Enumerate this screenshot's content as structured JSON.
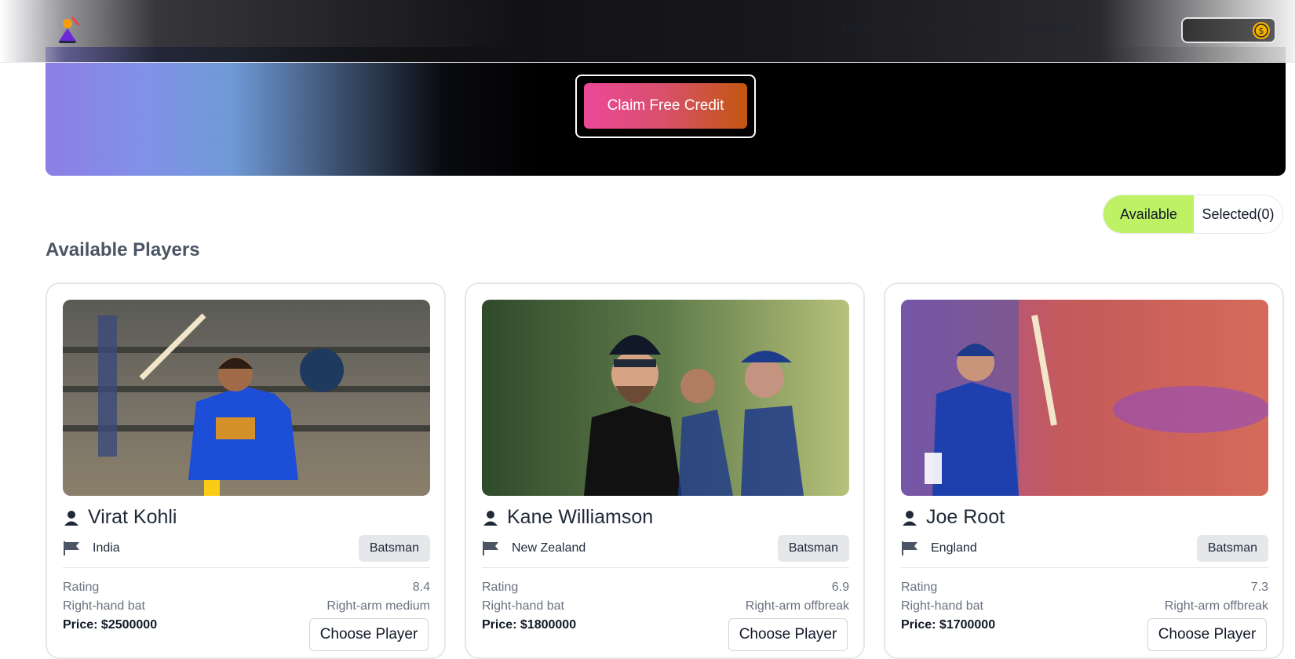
{
  "nav": {
    "links": [
      "Home",
      "Fixture",
      "Term",
      "Schedule"
    ],
    "coin_icon": "dollar-coin-icon"
  },
  "hero": {
    "claim_label": "Claim Free Credit"
  },
  "toggle": {
    "available_label": "Available",
    "selected_label": "Selected(0)"
  },
  "section_title": "Available Players",
  "players": [
    {
      "name": "Virat Kohli",
      "country": "India",
      "role": "Batsman",
      "rating_label": "Rating",
      "rating": "8.4",
      "batting": "Right-hand bat",
      "bowling": "Right-arm medium",
      "price": "Price: $2500000",
      "action": "Choose Player"
    },
    {
      "name": "Kane Williamson",
      "country": "New Zealand",
      "role": "Batsman",
      "rating_label": "Rating",
      "rating": "6.9",
      "batting": "Right-hand bat",
      "bowling": "Right-arm offbreak",
      "price": "Price: $1800000",
      "action": "Choose Player"
    },
    {
      "name": "Joe Root",
      "country": "England",
      "role": "Batsman",
      "rating_label": "Rating",
      "rating": "7.3",
      "batting": "Right-hand bat",
      "bowling": "Right-arm offbreak",
      "price": "Price: $1700000",
      "action": "Choose Player"
    }
  ],
  "colors": {
    "accent_green": "#bef264",
    "claim_gradient_start": "#ec4899",
    "claim_gradient_end": "#c2570f"
  }
}
